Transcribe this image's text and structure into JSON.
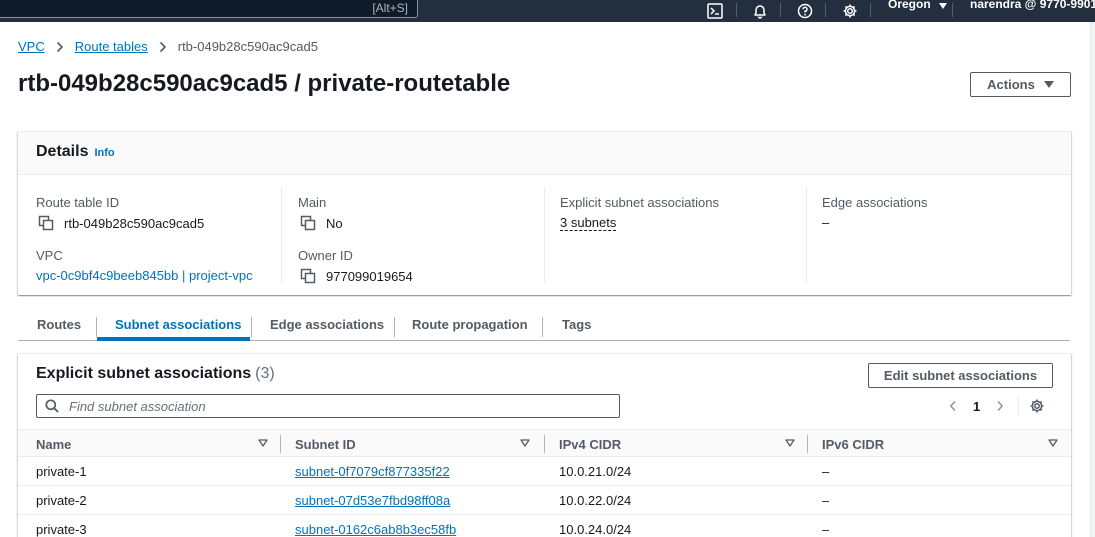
{
  "topbar": {
    "search_shortcut": "[Alt+S]",
    "region": "Oregon",
    "account": "narendra @ 9770-9901-9"
  },
  "breadcrumb": {
    "items": [
      {
        "label": "VPC"
      },
      {
        "label": "Route tables"
      },
      {
        "label": "rtb-049b28c590ac9cad5"
      }
    ]
  },
  "page": {
    "title": "rtb-049b28c590ac9cad5 / private-routetable",
    "actions_label": "Actions"
  },
  "details": {
    "title": "Details",
    "info": "Info",
    "route_table_id": {
      "label": "Route table ID",
      "value": "rtb-049b28c590ac9cad5"
    },
    "vpc": {
      "label": "VPC",
      "value": "vpc-0c9bf4c9beeb845bb | project-vpc"
    },
    "main": {
      "label": "Main",
      "value": "No"
    },
    "owner_id": {
      "label": "Owner ID",
      "value": "977099019654"
    },
    "explicit_assoc": {
      "label": "Explicit subnet associations",
      "value": "3 subnets"
    },
    "edge_assoc": {
      "label": "Edge associations",
      "value": "–"
    }
  },
  "tabs": [
    {
      "label": "Routes",
      "active": false
    },
    {
      "label": "Subnet associations",
      "active": true
    },
    {
      "label": "Edge associations",
      "active": false
    },
    {
      "label": "Route propagation",
      "active": false
    },
    {
      "label": "Tags",
      "active": false
    }
  ],
  "associations": {
    "title": "Explicit subnet associations",
    "count": "(3)",
    "edit_label": "Edit subnet associations",
    "filter_placeholder": "Find subnet association",
    "page_number": "1",
    "columns": [
      "Name",
      "Subnet ID",
      "IPv4 CIDR",
      "IPv6 CIDR"
    ],
    "rows": [
      {
        "name": "private-1",
        "subnet_id": "subnet-0f7079cf877335f22",
        "ipv4": "10.0.21.0/24",
        "ipv6": "–"
      },
      {
        "name": "private-2",
        "subnet_id": "subnet-07d53e7fbd98ff08a",
        "ipv4": "10.0.22.0/24",
        "ipv6": "–"
      },
      {
        "name": "private-3",
        "subnet_id": "subnet-0162c6ab8b3ec58fb",
        "ipv4": "10.0.24.0/24",
        "ipv6": "–"
      }
    ]
  },
  "colors": {
    "topbar": "#232f3e",
    "link": "#0073bb",
    "text": "#16191f",
    "secondary_text": "#545b64"
  }
}
